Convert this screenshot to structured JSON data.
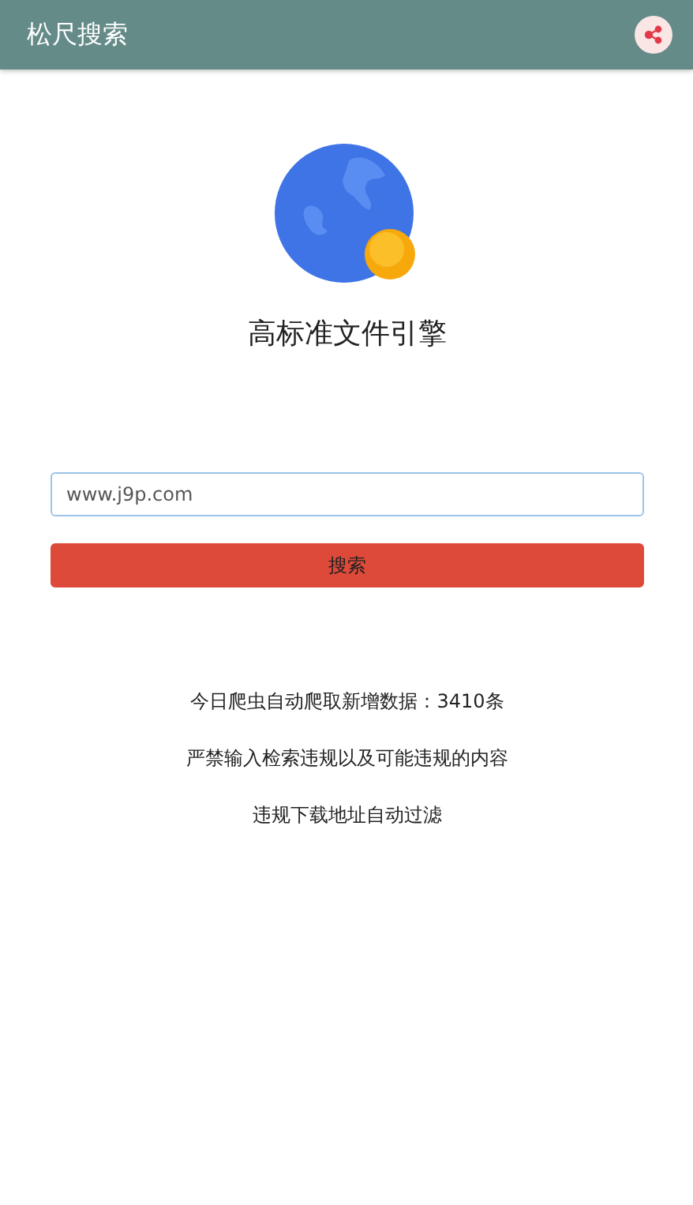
{
  "app_bar": {
    "title": "松尺搜索"
  },
  "hero": {
    "title": "高标准文件引擎"
  },
  "search": {
    "value": "www.j9p.com",
    "button": "搜索"
  },
  "notices": [
    "今日爬虫自动爬取新增数据：3410条",
    "严禁输入检索违规以及可能违规的内容",
    "违规下载地址自动过滤"
  ]
}
